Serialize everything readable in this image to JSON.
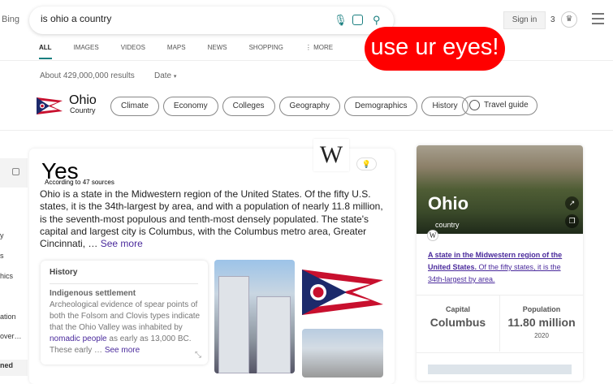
{
  "header": {
    "brand": "Bing",
    "query": "is ohio a country",
    "sign_in": "Sign in",
    "points": "3"
  },
  "tabs": [
    "ALL",
    "IMAGES",
    "VIDEOS",
    "MAPS",
    "NEWS",
    "SHOPPING",
    "MORE"
  ],
  "sticker": "use ur eyes!",
  "results": {
    "count": "About 429,000,000 results",
    "date_filter": "Date"
  },
  "entity": {
    "name": "Ohio",
    "type": "Country",
    "chips": [
      "Climate",
      "Economy",
      "Colleges",
      "Geography",
      "Demographics",
      "History"
    ],
    "travel_guide": "Travel guide"
  },
  "sidebar": {
    "fragments": [
      "y",
      "s",
      "hics",
      "ation",
      "over…",
      "ned"
    ]
  },
  "answer": {
    "title": "Yes",
    "sources": "According to 47 sources",
    "description": "Ohio is a state in the Midwestern region of the United States. Of the fifty U.S. states, it is the 34th-largest by area, and with a population of nearly 11.8 million, is the seventh-most populous and tenth-most densely populated. The state's capital and largest city is Columbus, with the Columbus metro area, Greater Cincinnati, …",
    "see_more": "See more",
    "wiki_logo": "W"
  },
  "history": {
    "heading": "History",
    "subheading": "Indigenous settlement",
    "body1": "Archeological evidence of spear points of both the Folsom and Clovis types indicate that the Ohio Valley was inhabited by",
    "link": "nomadic people",
    "body2": "as early as 13,000 BC. These early …",
    "see_more": "See more"
  },
  "panel": {
    "name": "Ohio",
    "type": "country",
    "desc_bold": "A state in the Midwestern region of the United States.",
    "desc_rest": "Of the fifty states, it is the 34th-largest by area.",
    "facts": [
      {
        "label": "Capital",
        "value": "Columbus"
      },
      {
        "label": "Population",
        "value": "11.80 million",
        "year": "2020"
      }
    ]
  },
  "colors": {
    "accent": "#1a7f80",
    "sticker": "#ff0000",
    "link": "#4a2a9c"
  }
}
